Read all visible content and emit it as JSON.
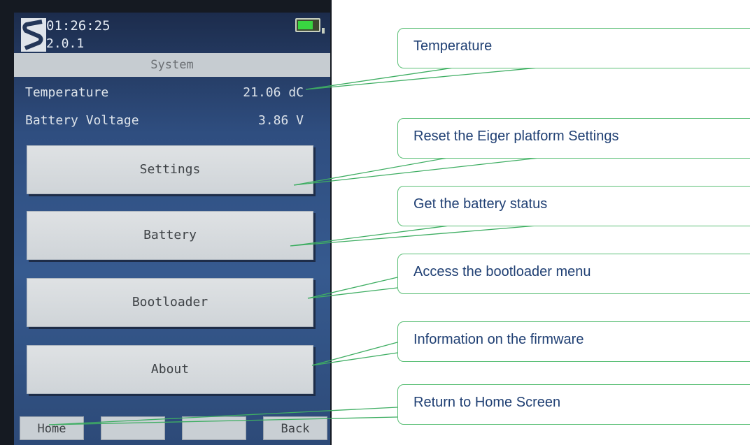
{
  "status": {
    "time": "01:26:25",
    "version": "2.0.1",
    "battery_level": 0.75
  },
  "screen_title": "System",
  "info": {
    "temperature_label": "Temperature",
    "temperature_value": "21.06 dC",
    "battery_voltage_label": "Battery Voltage",
    "battery_voltage_value": "3.86 V"
  },
  "buttons": {
    "settings": "Settings",
    "battery": "Battery",
    "bootloader": "Bootloader",
    "about": "About"
  },
  "softkeys": {
    "home": "Home",
    "key2": "",
    "key3": "",
    "back": "Back"
  },
  "callouts": {
    "temperature": "Temperature",
    "settings": "Reset the Eiger platform Settings",
    "battery": "Get the battery status",
    "bootloader": "Access the bootloader menu",
    "about": "Information on the firmware",
    "home": "Return to Home Screen"
  },
  "colors": {
    "callout_border": "#5bbf76",
    "callout_text": "#1f3f73",
    "battery_fill": "#39d641"
  }
}
